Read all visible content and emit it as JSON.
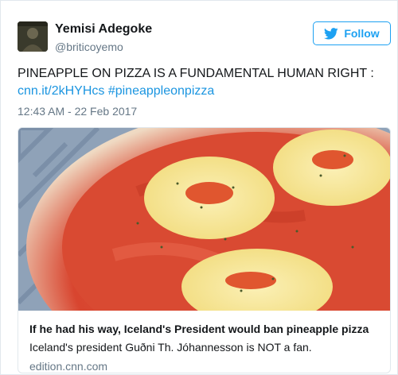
{
  "author": {
    "name": "Yemisi Adegoke",
    "handle": "@briticoyemo",
    "avatar_icon": "profile-photo"
  },
  "follow_button": {
    "label": "Follow",
    "icon": "twitter-bird-icon",
    "color": "#1da1f2"
  },
  "tweet": {
    "text": "PINEAPPLE ON PIZZA IS A FUNDAMENTAL HUMAN RIGHT :",
    "link": "cnn.it/2kHYHcs",
    "hashtag": "#pineappleonpizza",
    "timestamp": "12:43 AM - 22 Feb 2017"
  },
  "card": {
    "image_subject": "pizza-with-pineapple-rings",
    "title": "If he had his way, Iceland's President would ban pineapple pizza",
    "description": "Iceland's president Guðni Th. Jóhannesson is NOT a fan.",
    "domain": "edition.cnn.com"
  },
  "colors": {
    "link": "#1b95e0",
    "secondary_text": "#657786",
    "border": "#e1e8ed"
  }
}
